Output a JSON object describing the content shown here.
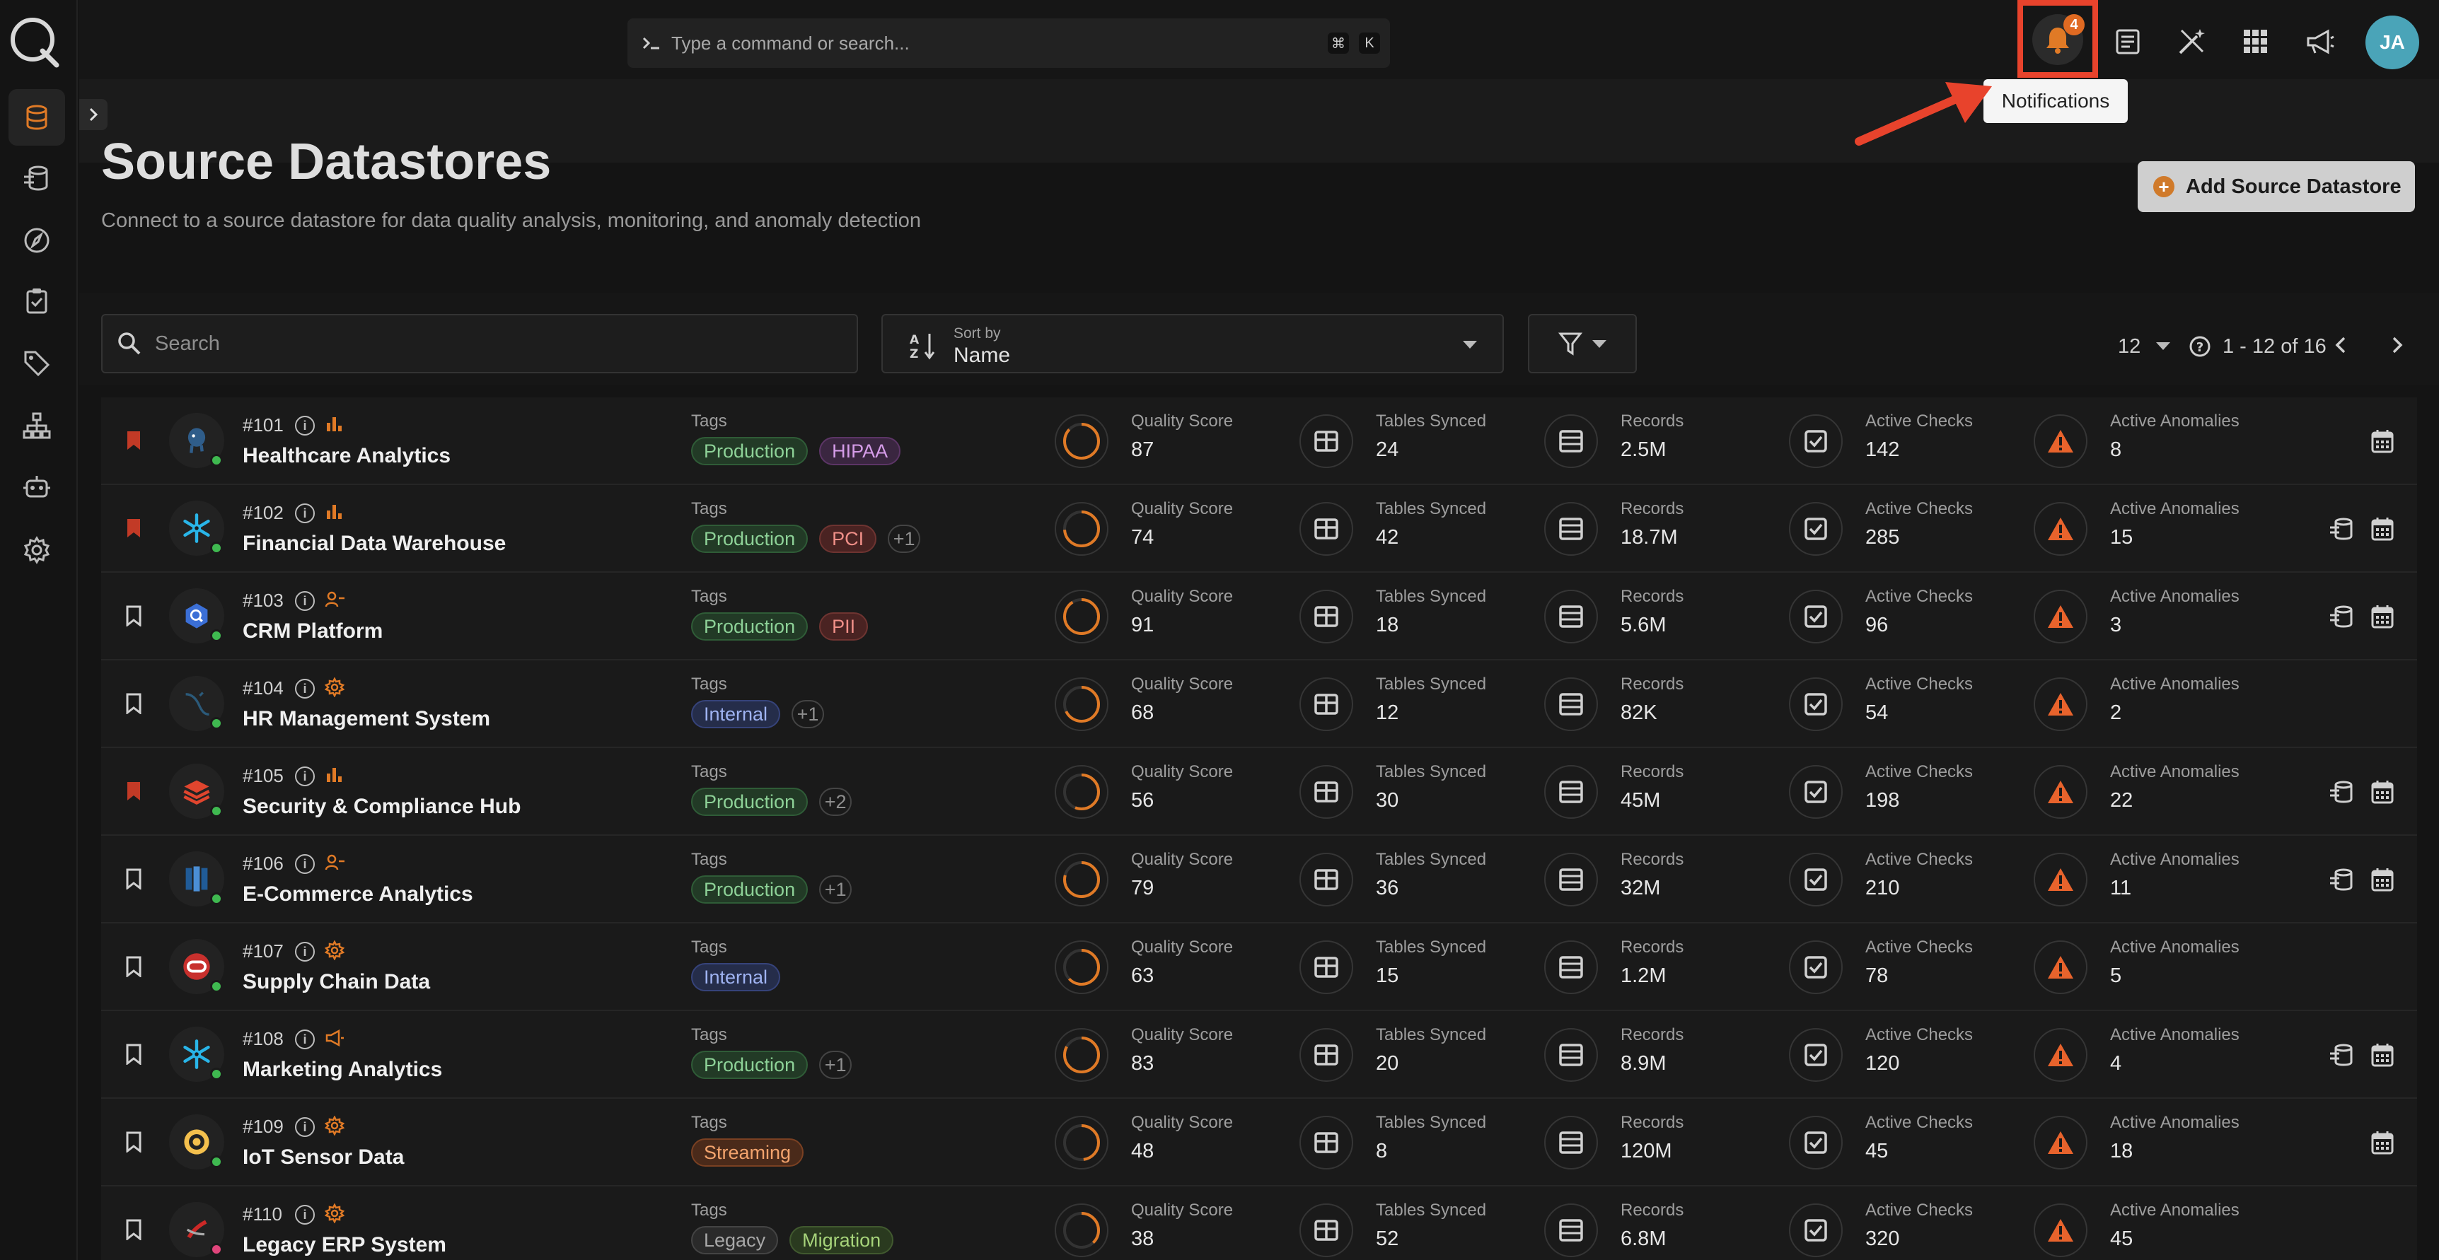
{
  "topbar": {
    "command_placeholder": "Type a command or search...",
    "shortcut_keys": [
      "⌘",
      "K"
    ],
    "notification_count": "4",
    "tooltip": "Notifications",
    "avatar_initials": "JA"
  },
  "sidebar": {
    "items": [
      {
        "name": "datastores",
        "icon": "database-icon",
        "active": true
      },
      {
        "name": "enrichment",
        "icon": "enrichment-icon",
        "active": false
      },
      {
        "name": "explore",
        "icon": "compass-icon",
        "active": false
      },
      {
        "name": "checks",
        "icon": "clipboard-check-icon",
        "active": false
      },
      {
        "name": "tags",
        "icon": "tag-icon",
        "active": false
      },
      {
        "name": "flows",
        "icon": "hierarchy-icon",
        "active": false
      },
      {
        "name": "agents",
        "icon": "robot-icon",
        "active": false
      },
      {
        "name": "settings",
        "icon": "gear-icon",
        "active": false
      }
    ]
  },
  "page": {
    "title": "Source Datastores",
    "subtitle": "Connect to a source datastore for data quality analysis, monitoring, and anomaly detection",
    "add_button": "Add Source Datastore"
  },
  "toolbar": {
    "search_placeholder": "Search",
    "sort_label": "Sort by",
    "sort_value": "Name",
    "per_page": "12",
    "range": "1 - 12 of 16"
  },
  "stat_labels": {
    "quality": "Quality Score",
    "tables": "Tables Synced",
    "records": "Records",
    "checks": "Active Checks",
    "anomalies": "Active Anomalies",
    "tags": "Tags"
  },
  "colors": {
    "accent": "#e06a22",
    "highlight_box": "#e8432c",
    "bookmark_on": "#c23a26",
    "status_green": "#3fb950",
    "status_pink": "#e0457b",
    "anomaly": "#e8632c"
  },
  "datastores": [
    {
      "id": "#101",
      "name": "Healthcare Analytics",
      "bookmarked": true,
      "logo": "postgres-icon",
      "type_icon": "chart-icon",
      "tags": [
        "Production",
        "HIPAA"
      ],
      "extra": "",
      "quality": "87",
      "tables": "24",
      "records": "2.5M",
      "checks": "142",
      "anomalies": "8",
      "status": "green",
      "actions": [
        "calendar"
      ]
    },
    {
      "id": "#102",
      "name": "Financial Data Warehouse",
      "bookmarked": true,
      "logo": "snowflake-icon",
      "type_icon": "chart-icon",
      "tags": [
        "Production",
        "PCI"
      ],
      "extra": "+1",
      "quality": "74",
      "tables": "42",
      "records": "18.7M",
      "checks": "285",
      "anomalies": "15",
      "status": "green",
      "actions": [
        "enrichment",
        "calendar"
      ]
    },
    {
      "id": "#103",
      "name": "CRM Platform",
      "bookmarked": false,
      "logo": "bigquery-icon",
      "type_icon": "user-icon",
      "tags": [
        "Production",
        "PII"
      ],
      "extra": "",
      "quality": "91",
      "tables": "18",
      "records": "5.6M",
      "checks": "96",
      "anomalies": "3",
      "status": "green",
      "actions": [
        "enrichment",
        "calendar"
      ]
    },
    {
      "id": "#104",
      "name": "HR Management System",
      "bookmarked": false,
      "logo": "mysql-icon",
      "type_icon": "gear-icon",
      "tags": [
        "Internal"
      ],
      "extra": "+1",
      "quality": "68",
      "tables": "12",
      "records": "82K",
      "checks": "54",
      "anomalies": "2",
      "status": "green",
      "actions": []
    },
    {
      "id": "#105",
      "name": "Security & Compliance Hub",
      "bookmarked": true,
      "logo": "databricks-icon",
      "type_icon": "chart-icon",
      "tags": [
        "Production"
      ],
      "extra": "+2",
      "quality": "56",
      "tables": "30",
      "records": "45M",
      "checks": "198",
      "anomalies": "22",
      "status": "green",
      "actions": [
        "enrichment",
        "calendar"
      ]
    },
    {
      "id": "#106",
      "name": "E-Commerce Analytics",
      "bookmarked": false,
      "logo": "redshift-icon",
      "type_icon": "user-icon",
      "tags": [
        "Production"
      ],
      "extra": "+1",
      "quality": "79",
      "tables": "36",
      "records": "32M",
      "checks": "210",
      "anomalies": "11",
      "status": "green",
      "actions": [
        "enrichment",
        "calendar"
      ]
    },
    {
      "id": "#107",
      "name": "Supply Chain Data",
      "bookmarked": false,
      "logo": "oracle-icon",
      "type_icon": "gear-icon",
      "tags": [
        "Internal"
      ],
      "extra": "",
      "quality": "63",
      "tables": "15",
      "records": "1.2M",
      "checks": "78",
      "anomalies": "5",
      "status": "green",
      "actions": []
    },
    {
      "id": "#108",
      "name": "Marketing Analytics",
      "bookmarked": false,
      "logo": "snowflake-icon",
      "type_icon": "megaphone-icon",
      "tags": [
        "Production"
      ],
      "extra": "+1",
      "quality": "83",
      "tables": "20",
      "records": "8.9M",
      "checks": "120",
      "anomalies": "4",
      "status": "green",
      "actions": [
        "enrichment",
        "calendar"
      ]
    },
    {
      "id": "#109",
      "name": "IoT Sensor Data",
      "bookmarked": false,
      "logo": "hive-icon",
      "type_icon": "gear-icon",
      "tags": [
        "Streaming"
      ],
      "extra": "",
      "quality": "48",
      "tables": "8",
      "records": "120M",
      "checks": "45",
      "anomalies": "18",
      "status": "green",
      "actions": [
        "calendar"
      ]
    },
    {
      "id": "#110",
      "name": "Legacy ERP System",
      "bookmarked": false,
      "logo": "sqlserver-icon",
      "type_icon": "gear-icon",
      "tags": [
        "Legacy",
        "Migration"
      ],
      "extra": "",
      "quality": "38",
      "tables": "52",
      "records": "6.8M",
      "checks": "320",
      "anomalies": "45",
      "status": "pink",
      "actions": []
    }
  ]
}
